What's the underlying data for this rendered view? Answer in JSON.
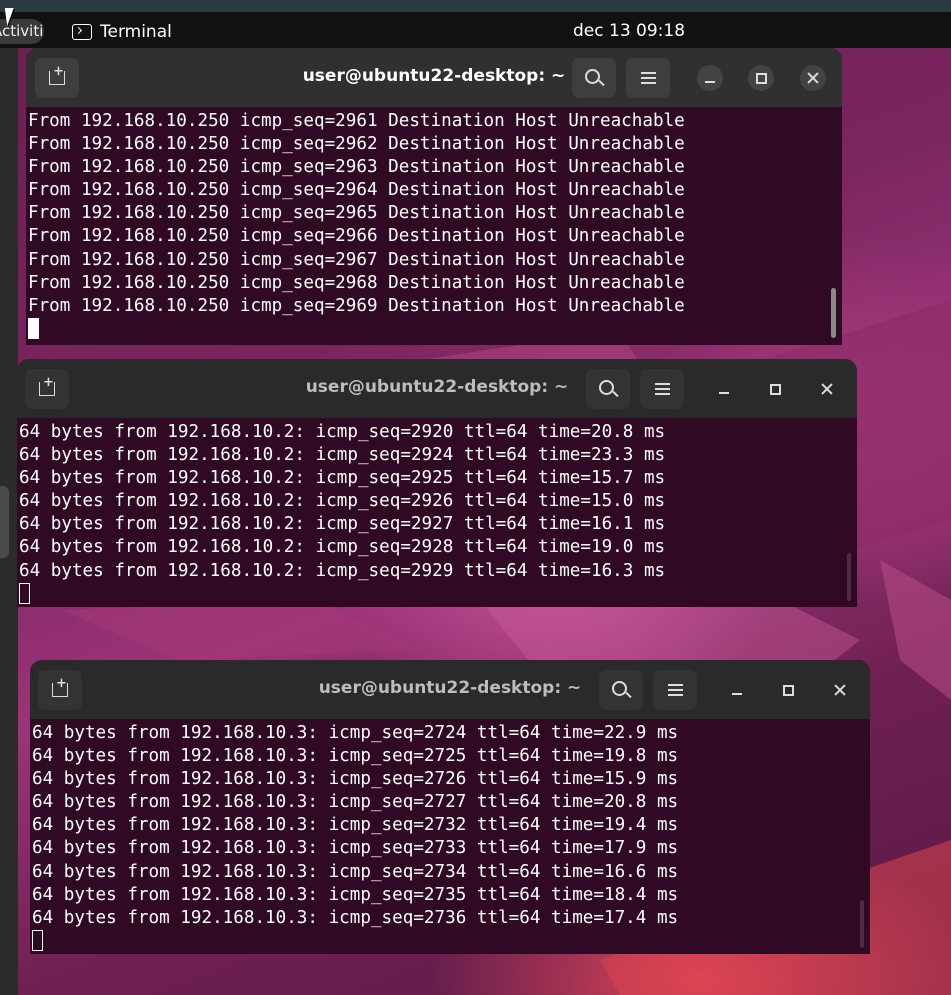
{
  "topbar": {
    "activities_label": "Activities",
    "app_name": "Terminal",
    "clock": "dec 13  09:18"
  },
  "colors": {
    "terminal_bg": "#300a24",
    "headerbar_bg": "#2a2a2a",
    "topbar_bg": "#111111"
  },
  "windows": [
    {
      "title": "user@ubuntu22-desktop: ~",
      "focused": true,
      "lines": [
        "From 192.168.10.250 icmp_seq=2961 Destination Host Unreachable",
        "From 192.168.10.250 icmp_seq=2962 Destination Host Unreachable",
        "From 192.168.10.250 icmp_seq=2963 Destination Host Unreachable",
        "From 192.168.10.250 icmp_seq=2964 Destination Host Unreachable",
        "From 192.168.10.250 icmp_seq=2965 Destination Host Unreachable",
        "From 192.168.10.250 icmp_seq=2966 Destination Host Unreachable",
        "From 192.168.10.250 icmp_seq=2967 Destination Host Unreachable",
        "From 192.168.10.250 icmp_seq=2968 Destination Host Unreachable",
        "From 192.168.10.250 icmp_seq=2969 Destination Host Unreachable"
      ]
    },
    {
      "title": "user@ubuntu22-desktop: ~",
      "focused": false,
      "lines": [
        "64 bytes from 192.168.10.2: icmp_seq=2920 ttl=64 time=20.8 ms",
        "64 bytes from 192.168.10.2: icmp_seq=2924 ttl=64 time=23.3 ms",
        "64 bytes from 192.168.10.2: icmp_seq=2925 ttl=64 time=15.7 ms",
        "64 bytes from 192.168.10.2: icmp_seq=2926 ttl=64 time=15.0 ms",
        "64 bytes from 192.168.10.2: icmp_seq=2927 ttl=64 time=16.1 ms",
        "64 bytes from 192.168.10.2: icmp_seq=2928 ttl=64 time=19.0 ms",
        "64 bytes from 192.168.10.2: icmp_seq=2929 ttl=64 time=16.3 ms"
      ]
    },
    {
      "title": "user@ubuntu22-desktop: ~",
      "focused": false,
      "lines": [
        "64 bytes from 192.168.10.3: icmp_seq=2724 ttl=64 time=22.9 ms",
        "64 bytes from 192.168.10.3: icmp_seq=2725 ttl=64 time=19.8 ms",
        "64 bytes from 192.168.10.3: icmp_seq=2726 ttl=64 time=15.9 ms",
        "64 bytes from 192.168.10.3: icmp_seq=2727 ttl=64 time=20.8 ms",
        "64 bytes from 192.168.10.3: icmp_seq=2732 ttl=64 time=19.4 ms",
        "64 bytes from 192.168.10.3: icmp_seq=2733 ttl=64 time=17.9 ms",
        "64 bytes from 192.168.10.3: icmp_seq=2734 ttl=64 time=16.6 ms",
        "64 bytes from 192.168.10.3: icmp_seq=2735 ttl=64 time=18.4 ms",
        "64 bytes from 192.168.10.3: icmp_seq=2736 ttl=64 time=17.4 ms"
      ]
    }
  ]
}
